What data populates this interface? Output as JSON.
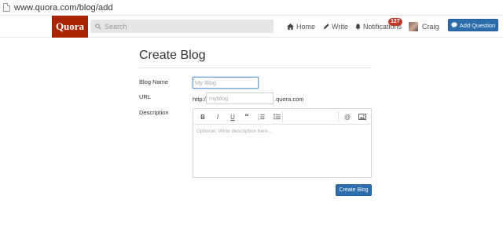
{
  "browser": {
    "url": "www.quora.com/blog/add"
  },
  "nav": {
    "logo": "Quora",
    "search_placeholder": "Search",
    "home_label": "Home",
    "write_label": "Write",
    "notifications_label": "Notifications",
    "notifications_count": "127",
    "user_name": "Craig",
    "add_question_label": "Add Question"
  },
  "form": {
    "title": "Create Blog",
    "blog_name_label": "Blog Name",
    "blog_name_placeholder": "My Blog",
    "url_label": "URL",
    "url_prefix": "http://",
    "url_placeholder": "myblog",
    "url_suffix": ".quora.com",
    "description_label": "Description",
    "description_placeholder": "Optional: Write description here...",
    "toolbar": {
      "bold": "B",
      "italic": "I",
      "underline": "U",
      "quote": "“",
      "mention": "@"
    },
    "submit_label": "Create Blog"
  },
  "colors": {
    "brand": "#a82400",
    "primary_button": "#2b6dad",
    "badge": "#c0392b"
  },
  "icons": [
    "page-icon",
    "search-icon",
    "home-icon",
    "pencil-icon",
    "bell-icon",
    "avatar",
    "speech-bubble-icon",
    "ordered-list-icon",
    "unordered-list-icon",
    "image-icon"
  ]
}
